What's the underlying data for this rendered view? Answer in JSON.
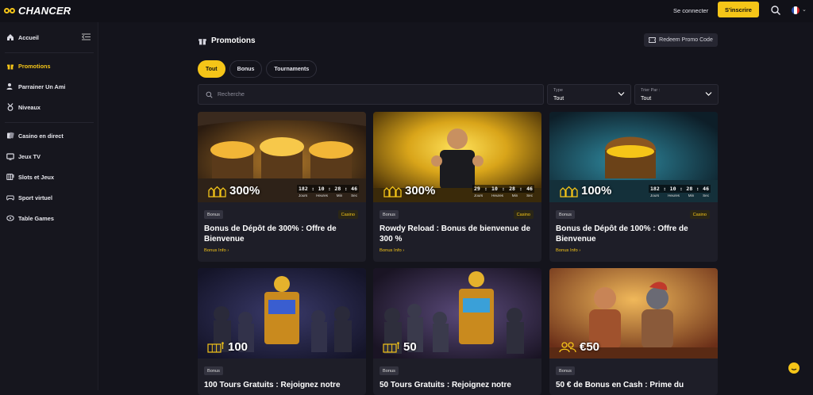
{
  "header": {
    "brand": "CHANCER",
    "login": "Se connecter",
    "signup": "S'inscrire"
  },
  "sidebar": {
    "items": [
      {
        "label": "Accueil",
        "icon": "home-icon"
      },
      {
        "label": "Promotions",
        "icon": "gift-icon",
        "active": true
      },
      {
        "label": "Parrainer Un Ami",
        "icon": "user-plus-icon"
      },
      {
        "label": "Niveaux",
        "icon": "medal-icon"
      },
      {
        "label": "Casino en direct",
        "icon": "cards-icon"
      },
      {
        "label": "Jeux TV",
        "icon": "tv-icon"
      },
      {
        "label": "Slots et Jeux",
        "icon": "slots-icon"
      },
      {
        "label": "Sport virtuel",
        "icon": "gamepad-icon"
      },
      {
        "label": "Table Games",
        "icon": "table-icon"
      }
    ]
  },
  "page": {
    "title": "Promotions",
    "redeem": "Redeem Promo Code",
    "tabs": [
      "Tout",
      "Bonus",
      "Tournaments"
    ],
    "search_placeholder": "Recherche",
    "filters": [
      {
        "label": "Type",
        "value": "Tout"
      },
      {
        "label": "Trier Par :",
        "value": "Tout"
      }
    ]
  },
  "countdown_labels": [
    "Jours",
    "Heures",
    "Min",
    "Sec"
  ],
  "cards": [
    {
      "type": "Bonus",
      "category": "Casino",
      "title": "Bonus de Dépôt de 300% : Offre de Bienvenue",
      "info": "Bonus Info ›",
      "amount": "300%",
      "countdown": [
        "182",
        "10",
        "28",
        "46"
      ],
      "theme": "gold-chests"
    },
    {
      "type": "Bonus",
      "category": "Casino",
      "title": "Rowdy Reload : Bonus de bienvenue de 300 %",
      "info": "Bonus Info ›",
      "amount": "300%",
      "countdown": [
        "29",
        "10",
        "28",
        "46"
      ],
      "theme": "hero"
    },
    {
      "type": "Bonus",
      "category": "Casino",
      "title": "Bonus de Dépôt de 100% : Offre de Bienvenue",
      "info": "Bonus Info ›",
      "amount": "100%",
      "countdown": [
        "182",
        "10",
        "28",
        "46"
      ],
      "theme": "chest-cave"
    },
    {
      "type": "Bonus",
      "category": "",
      "title": "100 Tours Gratuits : Rejoignez notre",
      "info": "",
      "amount": "100",
      "countdown": null,
      "theme": "knights"
    },
    {
      "type": "Bonus",
      "category": "",
      "title": "50 Tours Gratuits : Rejoignez notre",
      "info": "",
      "amount": "50",
      "countdown": null,
      "theme": "knights2"
    },
    {
      "type": "Bonus",
      "category": "",
      "title": "50 € de Bonus en Cash : Prime du",
      "info": "",
      "amount": "€50",
      "countdown": null,
      "theme": "arena"
    }
  ],
  "colors": {
    "accent": "#f5c518",
    "bg": "#14141c",
    "card": "#1e1e28"
  }
}
